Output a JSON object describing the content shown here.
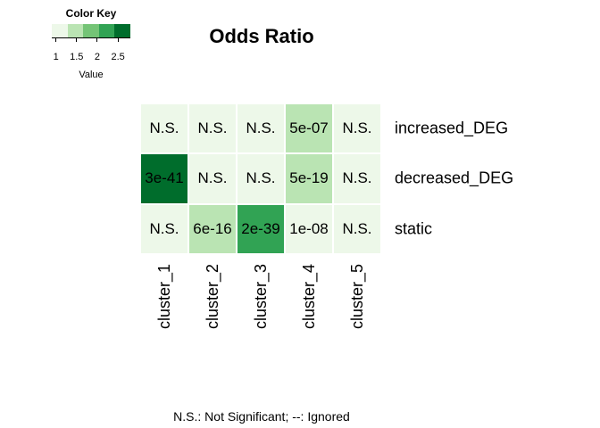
{
  "chart_data": {
    "type": "heatmap",
    "title": "Odds Ratio",
    "rows": [
      "increased_DEG",
      "decreased_DEG",
      "static"
    ],
    "columns": [
      "cluster_1",
      "cluster_2",
      "cluster_3",
      "cluster_4",
      "cluster_5"
    ],
    "cell_labels": [
      [
        "N.S.",
        "N.S.",
        "N.S.",
        "5e-07",
        "N.S."
      ],
      [
        "3e-41",
        "N.S.",
        "N.S.",
        "5e-19",
        "N.S."
      ],
      [
        "N.S.",
        "6e-16",
        "2e-39",
        "1e-08",
        "N.S."
      ]
    ],
    "values": [
      [
        1.0,
        1.0,
        1.0,
        1.6,
        1.0
      ],
      [
        2.8,
        1.0,
        1.0,
        1.6,
        1.0
      ],
      [
        1.0,
        1.6,
        2.1,
        1.2,
        1.0
      ]
    ],
    "color_key": {
      "title": "Color Key",
      "xlabel": "Value",
      "ticks": [
        "1",
        "1.5",
        "2",
        "2.5"
      ],
      "tick_values": [
        1,
        1.5,
        2,
        2.5
      ],
      "range": [
        0.9,
        2.8
      ],
      "colors": [
        "#edf8e9",
        "#bae4b3",
        "#74c476",
        "#31a354",
        "#006d2c"
      ]
    },
    "footnote": "N.S.: Not Significant; --: Ignored"
  }
}
